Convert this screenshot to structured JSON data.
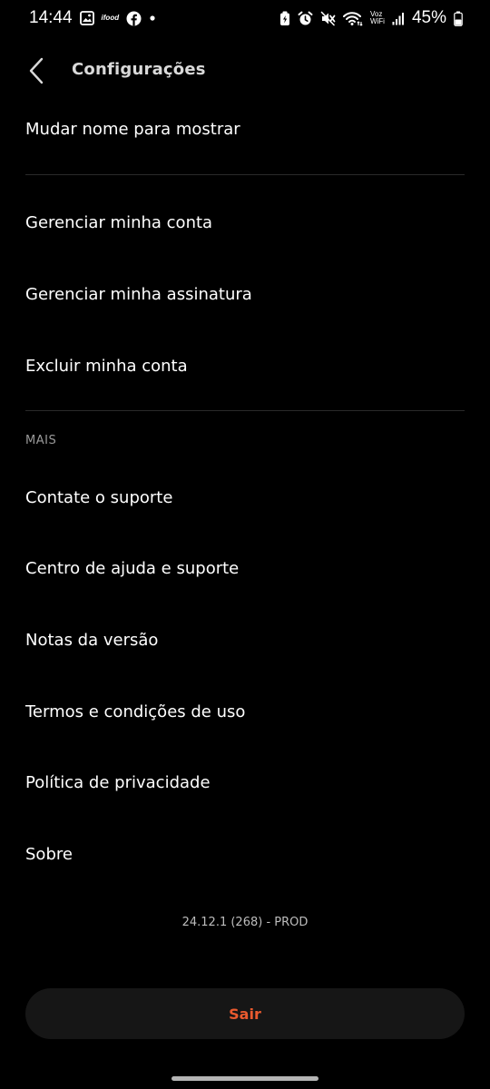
{
  "status_bar": {
    "time": "14:44",
    "battery": "45%",
    "wifi_label_top": "Voz",
    "wifi_label_bottom": "WiFi",
    "ifood_label": "ifood"
  },
  "header": {
    "title": "Configurações"
  },
  "account_items": [
    {
      "label": "Mudar nome para mostrar"
    },
    {
      "label": "Gerenciar minha conta"
    },
    {
      "label": "Gerenciar minha assinatura"
    },
    {
      "label": "Excluir minha conta"
    }
  ],
  "more_section": {
    "label": "MAIS",
    "items": [
      {
        "label": "Contate o suporte"
      },
      {
        "label": "Centro de ajuda e suporte"
      },
      {
        "label": "Notas da versão"
      },
      {
        "label": "Termos e condições de uso"
      },
      {
        "label": "Política de privacidade"
      },
      {
        "label": "Sobre"
      }
    ]
  },
  "version": "24.12.1 (268) - PROD",
  "logout_label": "Sair",
  "colors": {
    "background": "#000000",
    "accent": "#ea5a2e",
    "divider": "#2a2a2a"
  }
}
